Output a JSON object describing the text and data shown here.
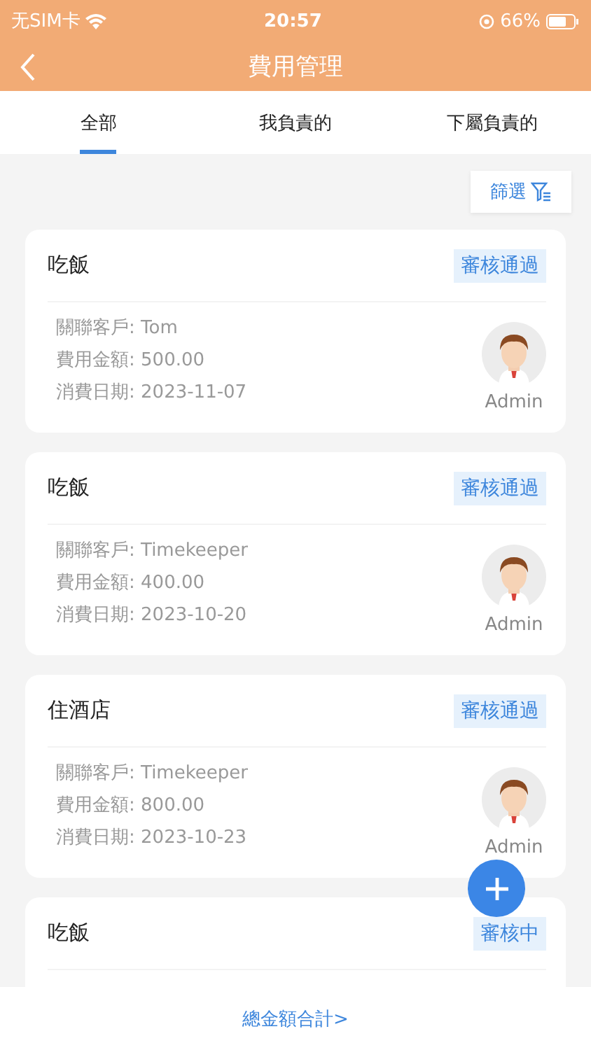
{
  "status_bar": {
    "carrier": "无SIM卡",
    "time": "20:57",
    "battery": "66%"
  },
  "header": {
    "title": "費用管理"
  },
  "tabs": [
    {
      "label": "全部",
      "selected": true
    },
    {
      "label": "我負責的",
      "selected": false
    },
    {
      "label": "下屬負責的",
      "selected": false
    }
  ],
  "filter_button": {
    "label": "篩選"
  },
  "expenses": [
    {
      "title": "吃飯",
      "status": "審核通過",
      "fields": [
        {
          "label": "關聯客戶:",
          "value": "Tom"
        },
        {
          "label": "費用金額:",
          "value": "500.00"
        },
        {
          "label": "消費日期:",
          "value": "2023-11-07"
        }
      ],
      "owner": "Admin"
    },
    {
      "title": "吃飯",
      "status": "審核通過",
      "fields": [
        {
          "label": "關聯客戶:",
          "value": "Timekeeper"
        },
        {
          "label": "費用金額:",
          "value": "400.00"
        },
        {
          "label": "消費日期:",
          "value": "2023-10-20"
        }
      ],
      "owner": "Admin"
    },
    {
      "title": "住酒店",
      "status": "審核通過",
      "fields": [
        {
          "label": "關聯客戶:",
          "value": "Timekeeper"
        },
        {
          "label": "費用金額:",
          "value": "800.00"
        },
        {
          "label": "消費日期:",
          "value": "2023-10-23"
        }
      ],
      "owner": "Admin"
    },
    {
      "title": "吃飯",
      "status": "審核中"
    }
  ],
  "footer": {
    "link": "總金額合計>"
  }
}
